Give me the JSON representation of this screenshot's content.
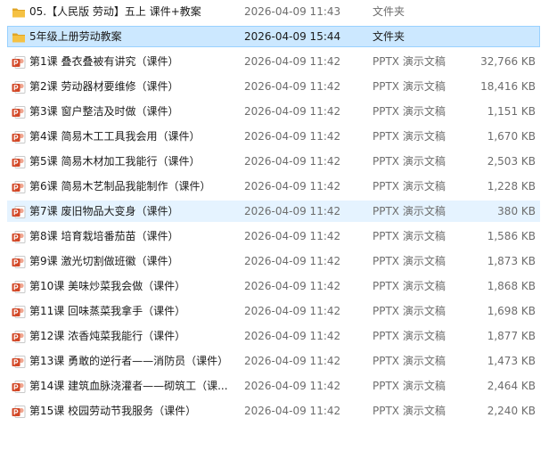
{
  "colors": {
    "selected_bg": "#cce8ff",
    "selected_border": "#99d1ff",
    "hover_bg": "#e5f3ff",
    "folder": "#f5c143",
    "pptx": "#d24726"
  },
  "files": [
    {
      "name": "05.【人民版 劳动】五上 课件+教案",
      "date": "2026-04-09 11:43",
      "type": "文件夹",
      "size": "",
      "icon": "folder-icon",
      "state": ""
    },
    {
      "name": "5年级上册劳动教案",
      "date": "2026-04-09 15:44",
      "type": "文件夹",
      "size": "",
      "icon": "folder-icon",
      "state": "selected"
    },
    {
      "name": "第1课 叠衣叠被有讲究（课件）",
      "date": "2026-04-09 11:42",
      "type": "PPTX 演示文稿",
      "size": "32,766 KB",
      "icon": "pptx-icon",
      "state": ""
    },
    {
      "name": "第2课 劳动器材要维修（课件）",
      "date": "2026-04-09 11:42",
      "type": "PPTX 演示文稿",
      "size": "18,416 KB",
      "icon": "pptx-icon",
      "state": ""
    },
    {
      "name": "第3课 窗户整洁及时做（课件）",
      "date": "2026-04-09 11:42",
      "type": "PPTX 演示文稿",
      "size": "1,151 KB",
      "icon": "pptx-icon",
      "state": ""
    },
    {
      "name": "第4课 简易木工工具我会用（课件）",
      "date": "2026-04-09 11:42",
      "type": "PPTX 演示文稿",
      "size": "1,670 KB",
      "icon": "pptx-icon",
      "state": ""
    },
    {
      "name": "第5课 简易木材加工我能行（课件）",
      "date": "2026-04-09 11:42",
      "type": "PPTX 演示文稿",
      "size": "2,503 KB",
      "icon": "pptx-icon",
      "state": ""
    },
    {
      "name": "第6课 简易木艺制品我能制作（课件）",
      "date": "2026-04-09 11:42",
      "type": "PPTX 演示文稿",
      "size": "1,228 KB",
      "icon": "pptx-icon",
      "state": ""
    },
    {
      "name": "第7课 废旧物品大变身（课件）",
      "date": "2026-04-09 11:42",
      "type": "PPTX 演示文稿",
      "size": "380 KB",
      "icon": "pptx-icon",
      "state": "hover"
    },
    {
      "name": "第8课 培育栽培番茄苗（课件）",
      "date": "2026-04-09 11:42",
      "type": "PPTX 演示文稿",
      "size": "1,586 KB",
      "icon": "pptx-icon",
      "state": ""
    },
    {
      "name": "第9课 激光切割做班徽（课件）",
      "date": "2026-04-09 11:42",
      "type": "PPTX 演示文稿",
      "size": "1,873 KB",
      "icon": "pptx-icon",
      "state": ""
    },
    {
      "name": "第10课 美味炒菜我会做（课件）",
      "date": "2026-04-09 11:42",
      "type": "PPTX 演示文稿",
      "size": "1,868 KB",
      "icon": "pptx-icon",
      "state": ""
    },
    {
      "name": "第11课 回味蒸菜我拿手（课件）",
      "date": "2026-04-09 11:42",
      "type": "PPTX 演示文稿",
      "size": "1,698 KB",
      "icon": "pptx-icon",
      "state": ""
    },
    {
      "name": "第12课 浓香炖菜我能行（课件）",
      "date": "2026-04-09 11:42",
      "type": "PPTX 演示文稿",
      "size": "1,877 KB",
      "icon": "pptx-icon",
      "state": ""
    },
    {
      "name": "第13课 勇敢的逆行者——消防员（课件）",
      "date": "2026-04-09 11:42",
      "type": "PPTX 演示文稿",
      "size": "1,473 KB",
      "icon": "pptx-icon",
      "state": ""
    },
    {
      "name": "第14课 建筑血脉浇灌者——砌筑工（课...",
      "date": "2026-04-09 11:42",
      "type": "PPTX 演示文稿",
      "size": "2,464 KB",
      "icon": "pptx-icon",
      "state": ""
    },
    {
      "name": "第15课 校园劳动节我服务（课件）",
      "date": "2026-04-09 11:42",
      "type": "PPTX 演示文稿",
      "size": "2,240 KB",
      "icon": "pptx-icon",
      "state": ""
    }
  ]
}
